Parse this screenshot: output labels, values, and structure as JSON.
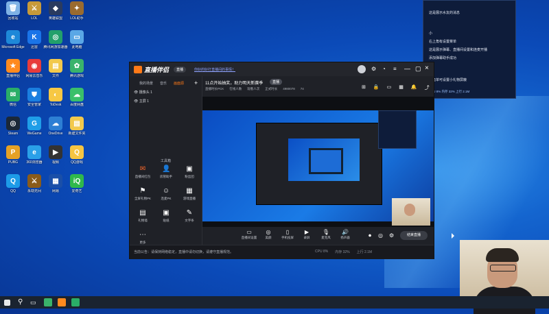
{
  "desktop": {
    "icons": [
      {
        "label": "回收站",
        "color": "#7fb2e5",
        "glyph": "🗑"
      },
      {
        "label": "LOL",
        "color": "#c79a3a",
        "glyph": "⚔"
      },
      {
        "label": "英雄联盟",
        "color": "#2a3b5f",
        "glyph": "◆"
      },
      {
        "label": "LOL助手",
        "color": "#9a6b2f",
        "glyph": "✦"
      },
      {
        "label": "Microsoft Edge",
        "color": "#1e88d8",
        "glyph": "e"
      },
      {
        "label": "迅雷",
        "color": "#1a74e8",
        "glyph": "K"
      },
      {
        "label": "腾讯网游加速器",
        "color": "#22a06b",
        "glyph": "◎"
      },
      {
        "label": "此电脑",
        "color": "#5aa7e6",
        "glyph": "▭"
      },
      {
        "label": "直播伴侣",
        "color": "#ff8a1e",
        "glyph": "★"
      },
      {
        "label": "网易云音乐",
        "color": "#e83b3b",
        "glyph": "◉"
      },
      {
        "label": "文件",
        "color": "#f2c94c",
        "glyph": "▤"
      },
      {
        "label": "腾讯游戏",
        "color": "#3ab36b",
        "glyph": "✿"
      },
      {
        "label": "微信",
        "color": "#2aae67",
        "glyph": "✉"
      },
      {
        "label": "安全管家",
        "color": "#1a7fe0",
        "glyph": "⛊"
      },
      {
        "label": "ToDesk",
        "color": "#f7c844",
        "glyph": "◐"
      },
      {
        "label": "百度网盘",
        "color": "#3ac06a",
        "glyph": "☁"
      },
      {
        "label": "Steam",
        "color": "#1b2838",
        "glyph": "◎"
      },
      {
        "label": "WeGame",
        "color": "#1f9ee8",
        "glyph": "G"
      },
      {
        "label": "OneDrive",
        "color": "#2d7fd4",
        "glyph": "☁"
      },
      {
        "label": "新建文件夹",
        "color": "#f2c94c",
        "glyph": "▤"
      },
      {
        "label": "PUBG",
        "color": "#e5a125",
        "glyph": "P"
      },
      {
        "label": "360浏览器",
        "color": "#2aa0e8",
        "glyph": "e"
      },
      {
        "label": "视频",
        "color": "#333",
        "glyph": "▶"
      },
      {
        "label": "QQ游戏",
        "color": "#f5c542",
        "glyph": "Q"
      },
      {
        "label": "QQ",
        "color": "#1d9be8",
        "glyph": "Q"
      },
      {
        "label": "永劫无间",
        "color": "#8a5b1a",
        "glyph": "⚔"
      },
      {
        "label": "网易",
        "color": "#1a4fa8",
        "glyph": "▦"
      },
      {
        "label": "爱奇艺",
        "color": "#2fb84b",
        "glyph": "iQ"
      }
    ]
  },
  "app": {
    "name": "直播伴侣",
    "badge": "直播",
    "notice": "你好的好打直播间的事情！",
    "sidebar_tabs": [
      "我的场景",
      "音乐",
      "画面源"
    ],
    "active_tab": "画面源",
    "sources": [
      "摄像头 1",
      "主屏 1"
    ],
    "toolbox_title": "工具箱",
    "tools": [
      {
        "label": "直播间红包",
        "glyph": "✉"
      },
      {
        "label": "房管助手",
        "glyph": "👤"
      },
      {
        "label": "粉丝团",
        "glyph": "▣"
      },
      {
        "label": "全屏礼物PK",
        "glyph": "⚑"
      },
      {
        "label": "连麦PK",
        "glyph": "☺"
      },
      {
        "label": "游戏直播",
        "glyph": "▦"
      },
      {
        "label": "礼物墙",
        "glyph": "▤"
      },
      {
        "label": "贴纸",
        "glyph": "▣"
      },
      {
        "label": "文字条",
        "glyph": "✎"
      },
      {
        "label": "更多",
        "glyph": "⋯"
      }
    ],
    "live_title": "11点开始抽奖，助力明天新赛季",
    "live_chip": "直播",
    "stats": [
      "直播时长PCK",
      "在线人数",
      "观看人次",
      "正式时长",
      "4980078",
      "74"
    ],
    "bottom_actions": [
      {
        "label": "直播间设置",
        "glyph": "▭"
      },
      {
        "label": "美颜",
        "glyph": "◎"
      },
      {
        "label": "手机投屏",
        "glyph": "▯"
      },
      {
        "label": "录屏",
        "glyph": "▶"
      },
      {
        "label": "麦克风",
        "glyph": "🎙"
      },
      {
        "label": "扬声器",
        "glyph": "🔊"
      }
    ],
    "end_button": "结束直播",
    "status_text": "当前公告：请保持网络稳定，直播中请勿切换，请遵守直播规范。",
    "status_right": [
      "CPU 8%",
      "内存 32%",
      "上行 2.1M"
    ]
  },
  "notification": {
    "lines": [
      "这是展示水友的消息",
      "",
      "小",
      "右上角有设置菜单",
      "这是展示弹幕、直播间设置和连麦开播",
      "添加弹幕助手成功",
      "",
      "点亮单可设置小礼物屏蔽",
      "CPU 8%  内存 32%  上行 2.1M"
    ]
  },
  "taskbar": {
    "items": [
      "开始",
      "搜索",
      "任务视图",
      "LOL",
      "直播伴侣",
      "微信"
    ]
  }
}
